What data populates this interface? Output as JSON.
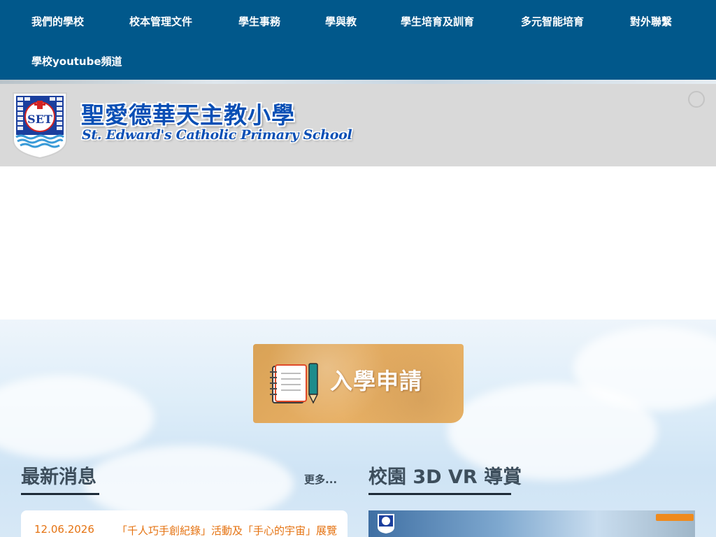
{
  "nav": {
    "items": [
      {
        "label": "我們的學校"
      },
      {
        "label": "校本管理文件"
      },
      {
        "label": "學生事務"
      },
      {
        "label": "學與教"
      },
      {
        "label": "學生培育及訓育"
      },
      {
        "label": "多元智能培育"
      },
      {
        "label": "對外聯繫"
      },
      {
        "label": "學校youtube頻道"
      }
    ]
  },
  "header": {
    "school_name_zh": "聖愛德華天主教小學",
    "school_name_en": "St. Edward's Catholic Primary School",
    "crest_icon": "school-crest-icon",
    "loading_icon": "loading-spinner-icon"
  },
  "admission": {
    "label": "入學申請",
    "icon": "notebook-pencil-icon"
  },
  "news": {
    "title": "最新消息",
    "more_label": "更多...",
    "items": [
      {
        "date": "12.06.2026",
        "text": "「千人巧手創紀錄」活動及「手心的宇宙」展覽"
      }
    ]
  },
  "vr": {
    "title": "校園 3D VR 導賞"
  },
  "colors": {
    "nav_bg": "#01588b",
    "header_bg": "#d9d9d9",
    "brand_blue": "#0a4fb5",
    "accent_orange": "#e57312",
    "heading": "#3d4e5c"
  }
}
